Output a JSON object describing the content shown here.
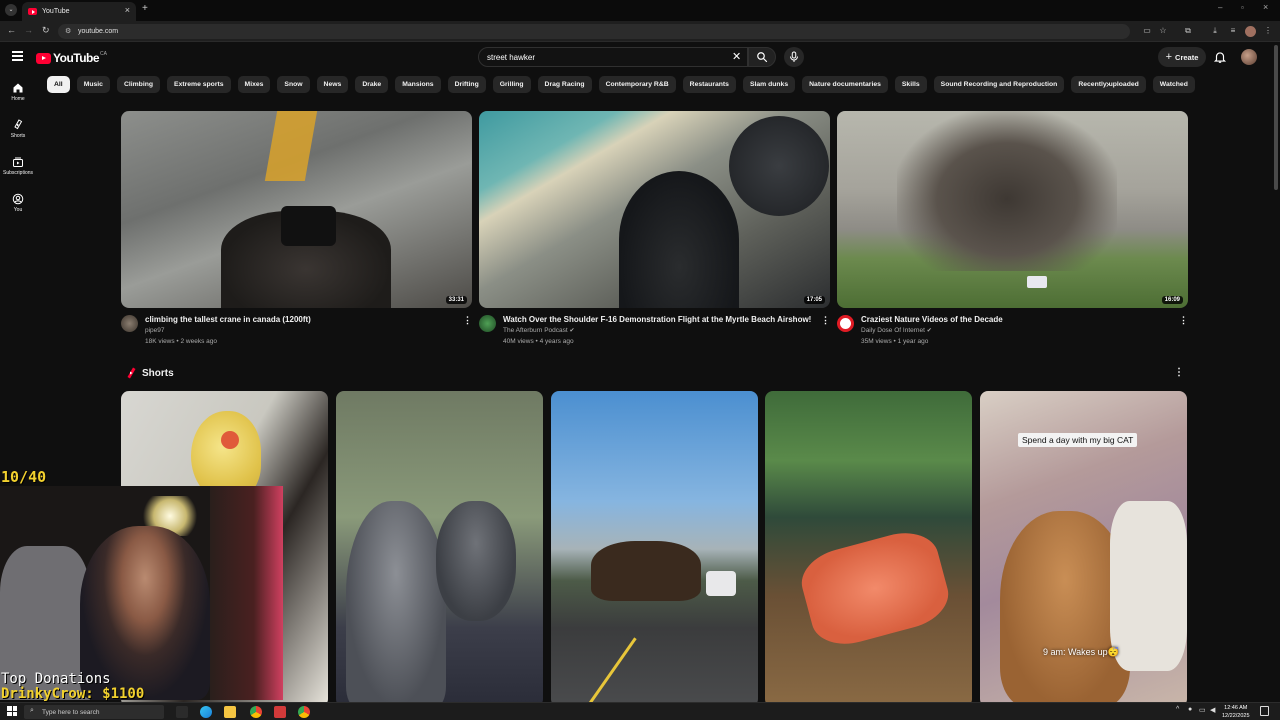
{
  "browser": {
    "tab_title": "YouTube",
    "url": "youtube.com"
  },
  "header": {
    "logo_text": "YouTube",
    "country_code": "CA",
    "search_value": "street hawker",
    "create_label": "Create"
  },
  "sidebar": {
    "items": [
      {
        "label": "Home",
        "icon": "home-icon"
      },
      {
        "label": "Shorts",
        "icon": "shorts-icon"
      },
      {
        "label": "Subscriptions",
        "icon": "subscriptions-icon"
      },
      {
        "label": "You",
        "icon": "you-icon"
      }
    ]
  },
  "chips": [
    "All",
    "Music",
    "Climbing",
    "Extreme sports",
    "Mixes",
    "Snow",
    "News",
    "Drake",
    "Mansions",
    "Drifting",
    "Grilling",
    "Drag Racing",
    "Contemporary R&B",
    "Restaurants",
    "Slam dunks",
    "Nature documentaries",
    "Skills",
    "Sound Recording and Reproduction",
    "Recently uploaded",
    "Watched"
  ],
  "videos": [
    {
      "title": "climbing the tallest crane in canada (1200ft)",
      "channel": "pipe97",
      "stats": "18K views • 2 weeks ago",
      "duration": "33:31"
    },
    {
      "title": "Watch Over the Shoulder F-16 Demonstration Flight at the Myrtle Beach Airshow!",
      "channel": "The Afterburn Podcast",
      "stats": "40M views • 4 years ago",
      "duration": "17:05"
    },
    {
      "title": "Craziest Nature Videos of the Decade",
      "channel": "Daily Dose Of Internet",
      "stats": "35M views • 1 year ago",
      "duration": "16:09"
    }
  ],
  "shorts": {
    "heading": "Shorts",
    "captions": {
      "cat_top": "Spend a day with my big CAT",
      "cat_bottom": "9 am: Wakes up😴"
    }
  },
  "stream_overlay": {
    "counter": "10/40",
    "donations_title": "Top Donations",
    "donations_entry": "DrinkyCrow: $1100"
  },
  "taskbar": {
    "search_placeholder": "Type here to search",
    "time": "12:46 AM",
    "date": "12/22/2025"
  },
  "colors": {
    "background": "#0f0f0f",
    "chip": "#272727",
    "youtube_red": "#ff0033",
    "overlay_yellow": "#f2d12e"
  }
}
